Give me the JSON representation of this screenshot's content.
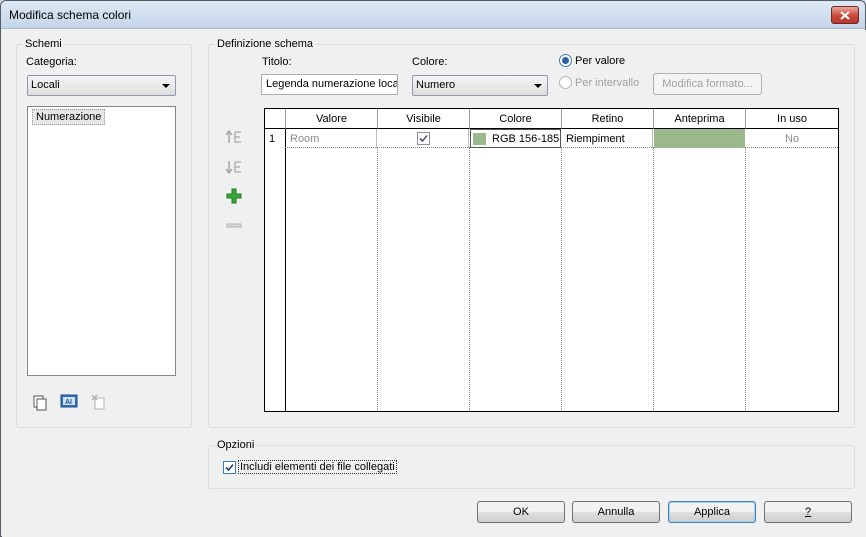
{
  "window": {
    "title": "Modifica schema colori"
  },
  "schemes": {
    "group_label": "Schemi",
    "category_label": "Categoria:",
    "category_value": "Locali",
    "list_items": [
      "Numerazione"
    ]
  },
  "definition": {
    "group_label": "Definizione schema",
    "title_label": "Titolo:",
    "title_value": "Legenda numerazione local",
    "color_label": "Colore:",
    "color_value": "Numero",
    "radio_by_value": "Per valore",
    "radio_by_range": "Per intervallo",
    "edit_format_button": "Modifica formato...",
    "table": {
      "headers": [
        "Valore",
        "Visibile",
        "Colore",
        "Retino",
        "Anteprima",
        "In uso"
      ],
      "rows": [
        {
          "index": "1",
          "value": "Room",
          "visible": true,
          "color": "RGB 156-185",
          "swatch_color": "#9cb98e",
          "pattern": "Riempiment",
          "preview_color": "#9cb98e",
          "in_use": "No"
        }
      ]
    }
  },
  "options": {
    "group_label": "Opzioni",
    "include_linked_label": "Includi elementi dei file collegati",
    "include_linked_checked": true
  },
  "buttons": {
    "ok": "OK",
    "cancel": "Annulla",
    "apply": "Applica",
    "help": "?"
  }
}
